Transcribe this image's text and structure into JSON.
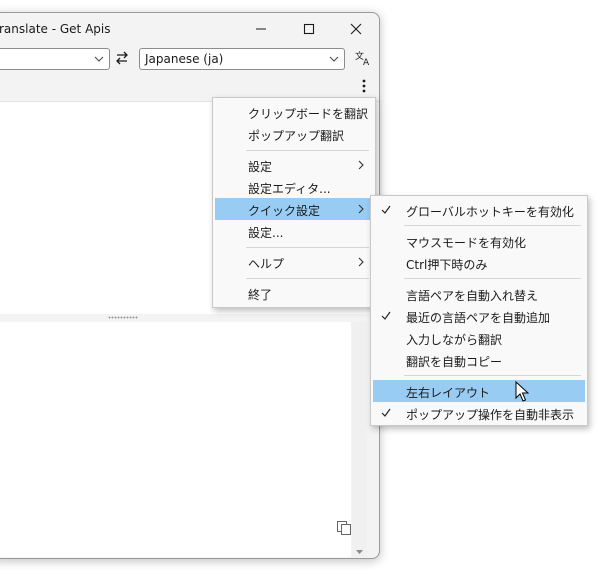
{
  "window": {
    "title": "ranslate - Get Apis",
    "target_language": "Japanese (ja)"
  },
  "context_menu": {
    "items": [
      {
        "label": "クリップボードを翻訳"
      },
      {
        "label": "ポップアップ翻訳"
      },
      {
        "label": "設定"
      },
      {
        "label": "設定エディタ..."
      },
      {
        "label": "クイック設定"
      },
      {
        "label": "設定..."
      },
      {
        "label": "ヘルプ"
      },
      {
        "label": "終了"
      }
    ]
  },
  "quick_settings_menu": {
    "items": [
      {
        "label": "グローバルホットキーを有効化",
        "checked": true
      },
      {
        "label": "マウスモードを有効化",
        "checked": false
      },
      {
        "label": "Ctrl押下時のみ",
        "checked": false
      },
      {
        "label": "言語ペアを自動入れ替え",
        "checked": false
      },
      {
        "label": "最近の言語ペアを自動追加",
        "checked": true
      },
      {
        "label": "入力しながら翻訳",
        "checked": false
      },
      {
        "label": "翻訳を自動コピー",
        "checked": false
      },
      {
        "label": "左右レイアウト",
        "checked": false
      },
      {
        "label": "ポップアップ操作を自動非表示",
        "checked": true
      }
    ]
  },
  "colors": {
    "highlight": "#99ccf3",
    "menu_bg": "#f9f9f9",
    "window_bg": "#f3f3f3"
  },
  "icons": [
    "minimize-icon",
    "maximize-icon",
    "close-icon",
    "chevron-down-icon",
    "swap-icon",
    "translate-icon",
    "more-vertical-icon",
    "copy-icon",
    "chevron-right-icon",
    "checkmark-icon",
    "mouse-cursor-icon"
  ]
}
